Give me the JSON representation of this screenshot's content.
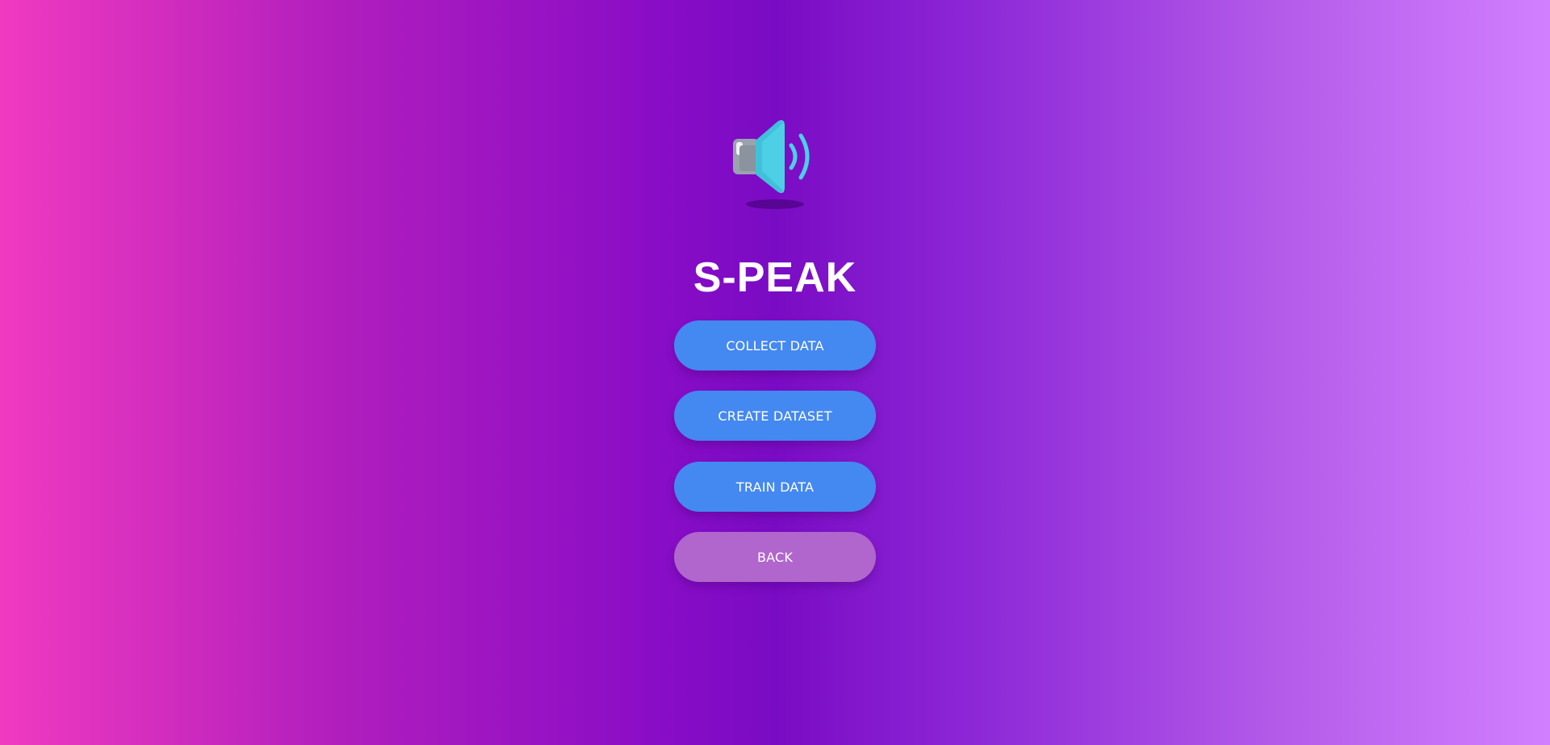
{
  "app": {
    "title": "S-PEAK",
    "icon": "speaker-icon"
  },
  "menu": {
    "buttons": [
      {
        "label": "COLLECT DATA",
        "name": "collect-data-button"
      },
      {
        "label": "CREATE DATASET",
        "name": "create-dataset-button"
      },
      {
        "label": "TRAIN DATA",
        "name": "train-data-button"
      },
      {
        "label": "BACK",
        "name": "back-button"
      }
    ]
  },
  "colors": {
    "gradient_left": "#f03ac0",
    "gradient_mid": "#7a0bc4",
    "gradient_right": "#d27fff",
    "button_primary": "#4488f2",
    "button_back": "#b066cc",
    "speaker_body": "#4dcfe6",
    "speaker_back": "#9aa3ad"
  }
}
